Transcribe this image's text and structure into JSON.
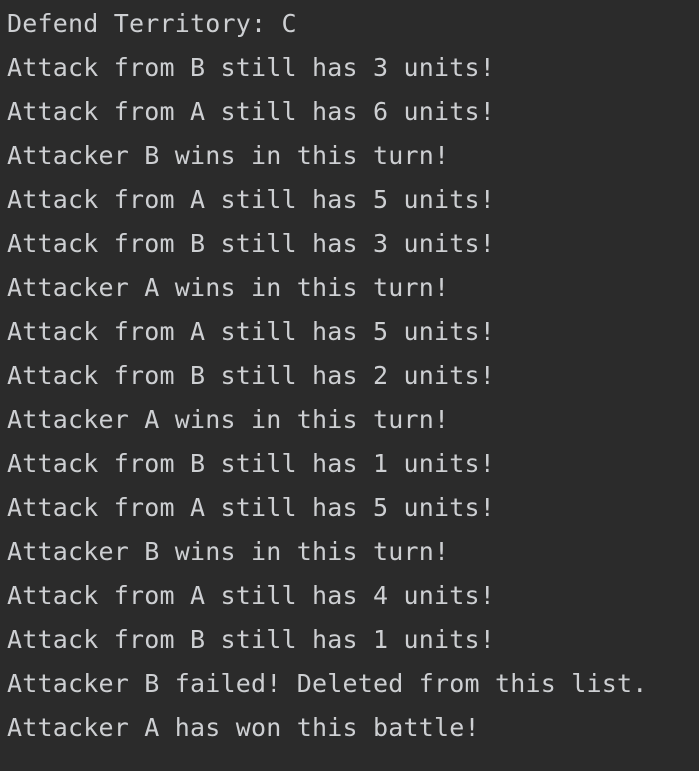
{
  "console": {
    "lines": [
      "Defend Territory: C",
      "Attack from B still has 3 units!",
      "Attack from A still has 6 units!",
      "Attacker B wins in this turn!",
      "Attack from A still has 5 units!",
      "Attack from B still has 3 units!",
      "Attacker A wins in this turn!",
      "Attack from A still has 5 units!",
      "Attack from B still has 2 units!",
      "Attacker A wins in this turn!",
      "Attack from B still has 1 units!",
      "Attack from A still has 5 units!",
      "Attacker B wins in this turn!",
      "Attack from A still has 4 units!",
      "Attack from B still has 1 units!",
      "Attacker B failed! Deleted from this list.",
      "Attacker A has won this battle!"
    ]
  }
}
